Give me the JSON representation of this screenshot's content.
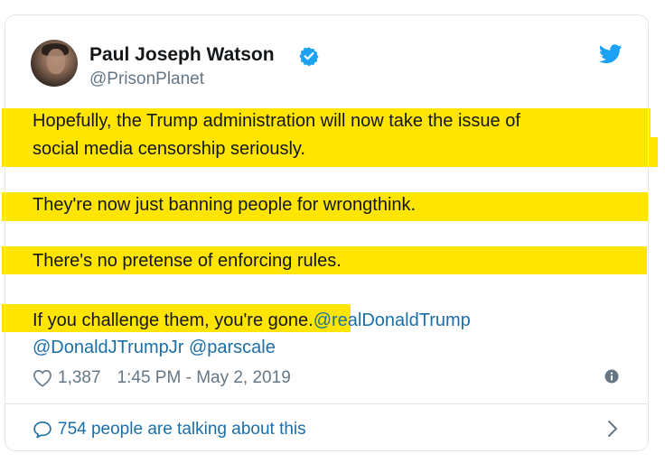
{
  "author": {
    "name": "Paul Joseph Watson",
    "handle": "@PrisonPlanet"
  },
  "icons": {
    "verified": "verified-badge-icon",
    "brand": "twitter-bird-icon",
    "like": "heart-icon",
    "info": "info-icon",
    "reply": "speech-bubble-icon",
    "more": "chevron-right-icon"
  },
  "colors": {
    "highlight": "#ffe500",
    "link": "#1b6fa8",
    "brand": "#1da1f2",
    "text": "#14171a",
    "muted": "#657786"
  },
  "tweet": {
    "lines": [
      "Hopefully, the Trump administration will now take the issue of",
      "social media censorship seriously.",
      "They're now just banning people for wrongthink.",
      "There's no pretense of enforcing rules.",
      "If you challenge them, you're gone."
    ],
    "mentions": [
      "@realDonaldTrump",
      "@DonaldJTrumpJr",
      "@parscale"
    ]
  },
  "meta": {
    "likes": "1,387",
    "timestamp": "1:45 PM - May 2, 2019"
  },
  "footer": {
    "talking": "754 people are talking about this"
  }
}
